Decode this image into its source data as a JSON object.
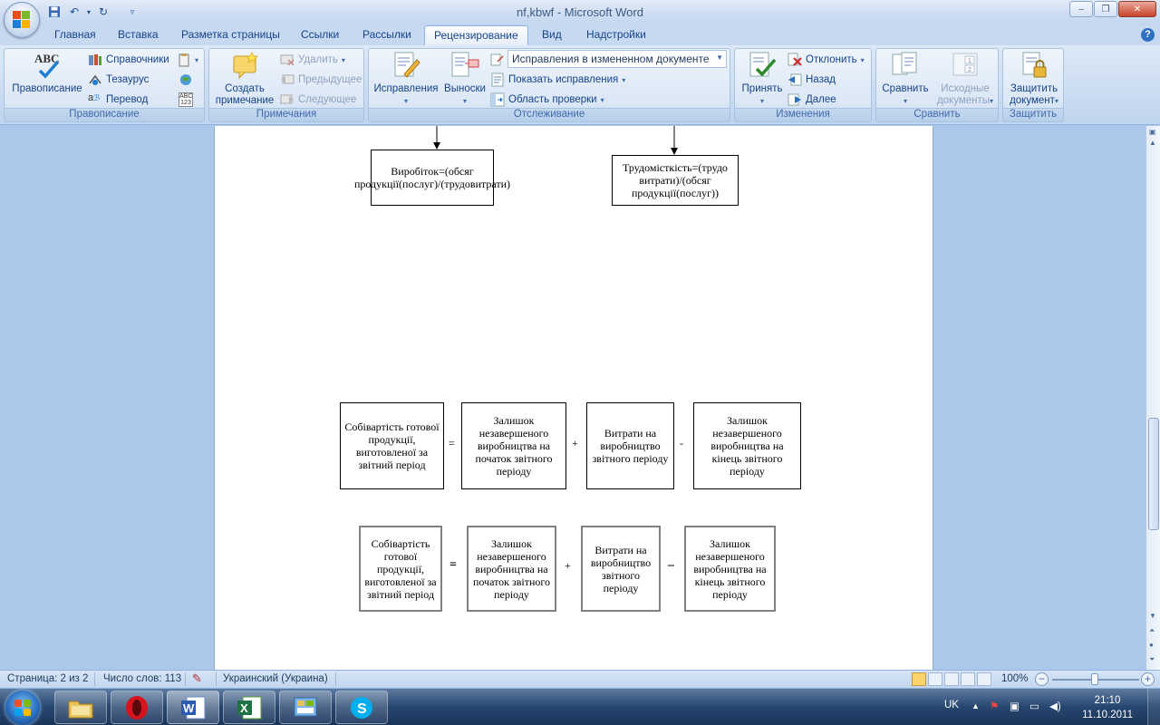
{
  "window": {
    "title": "nf,kbwf - Microsoft Word",
    "minimize": "–",
    "maximize": "❐",
    "close": "✕"
  },
  "tabs": [
    "Главная",
    "Вставка",
    "Разметка страницы",
    "Ссылки",
    "Рассылки",
    "Рецензирование",
    "Вид",
    "Надстройки"
  ],
  "active_tab": "Рецензирование",
  "ribbon": {
    "spelling": {
      "label": "Правописание",
      "spellcheck": "Правописание",
      "references": "Справочники",
      "thesaurus": "Тезаурус",
      "translate": "Перевод",
      "abc_icon": "ABC"
    },
    "comments": {
      "label": "Примечания",
      "create": "Создать примечание",
      "delete": "Удалить",
      "previous": "Предыдущее",
      "next": "Следующее"
    },
    "tracking": {
      "label": "Отслеживание",
      "track_changes": "Исправления",
      "balloons": "Выноски",
      "display_mode": "Исправления в измененном документе",
      "show_markup": "Показать исправления",
      "review_pane": "Область проверки"
    },
    "changes": {
      "label": "Изменения",
      "accept": "Принять",
      "reject": "Отклонить",
      "previous": "Назад",
      "next": "Далее"
    },
    "compare": {
      "label": "Сравнить",
      "compare": "Сравнить",
      "source": "Исходные документы"
    },
    "protect": {
      "label": "Защитить",
      "protect_doc": "Защитить документ"
    }
  },
  "document": {
    "top_boxes": [
      {
        "text": "Виробіток=(обсяг продукції(послуг)/(трудовитрати)"
      },
      {
        "text": "Трудомісткість=(трудо витрати)/(обсяг продукції(послуг))"
      }
    ],
    "row1": [
      "Собівартість готової продукції, виготовленої за звітний період",
      "Залишок незавершеного виробництва на початок звітного періоду",
      "Витрати на виробництво звітного періоду",
      "Залишок незавершеного виробництва на кінець звітного періоду"
    ],
    "row1_ops": [
      "=",
      "+",
      "-"
    ],
    "row2": [
      "Собівартість готової продукції, виготовленої за звітний період",
      "Залишок незавершеного виробництва на початок звітного періоду",
      "Витрати на виробництво звітного періоду",
      "Залишок незавершеного виробництва на кінець звітного періоду"
    ],
    "row2_ops": [
      "=",
      "+",
      "–"
    ]
  },
  "status": {
    "page": "Страница: 2 из 2",
    "words": "Число слов: 113",
    "language": "Украинский (Украина)",
    "zoom": "100%",
    "zoom_level": 100
  },
  "taskbar": {
    "lang": "UK",
    "time": "21:10",
    "date": "11.10.2011"
  },
  "colors": {
    "ribbon_text": "#15428b",
    "accent": "#2e6fc3"
  }
}
